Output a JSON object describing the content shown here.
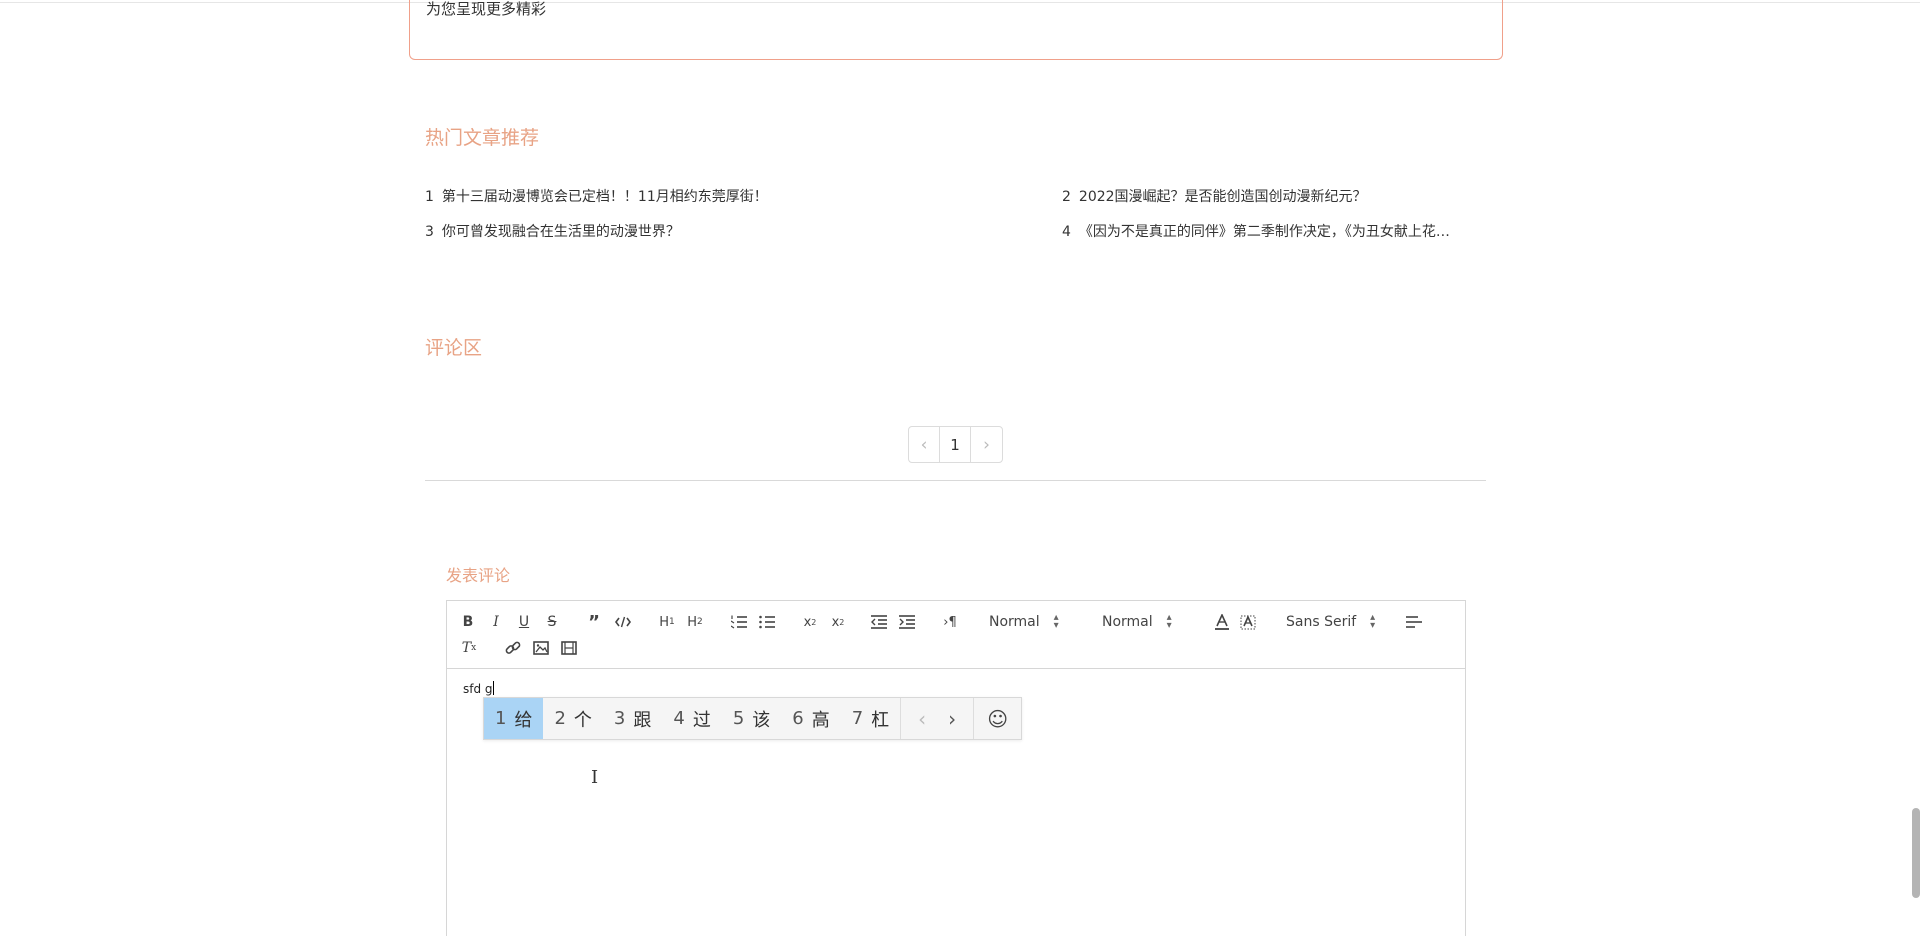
{
  "banner": {
    "text": "为您呈现更多精彩"
  },
  "hot_articles": {
    "title": "热门文章推荐",
    "items": [
      {
        "num": "1",
        "title": "第十三届动漫博览会已定档！！11月相约东莞厚街！"
      },
      {
        "num": "2",
        "title": "2022国漫崛起？是否能创造国创动漫新纪元？"
      },
      {
        "num": "3",
        "title": "你可曾发现融合在生活里的动漫世界？"
      },
      {
        "num": "4",
        "title": "《因为不是真正的同伴》第二季制作决定，《为丑女献上花…"
      }
    ]
  },
  "comments": {
    "title": "评论区"
  },
  "pagination": {
    "prev": "‹",
    "current": "1",
    "next": "›"
  },
  "post_comment": {
    "title": "发表评论",
    "toolbar": {
      "header_select": "Normal",
      "size_select": "Normal",
      "font_select": "Sans Serif"
    },
    "editor_text": "sfd g"
  },
  "ime": {
    "candidates": [
      {
        "n": "1",
        "c": "给"
      },
      {
        "n": "2",
        "c": "个"
      },
      {
        "n": "3",
        "c": "跟"
      },
      {
        "n": "4",
        "c": "过"
      },
      {
        "n": "5",
        "c": "该"
      },
      {
        "n": "6",
        "c": "高"
      },
      {
        "n": "7",
        "c": "杠"
      }
    ],
    "prev": "‹",
    "next": "›",
    "emoji": "☺"
  },
  "colors": {
    "accent": "#e8a385",
    "border_accent": "#f0a08a",
    "ime_selected": "#aad4f5"
  }
}
